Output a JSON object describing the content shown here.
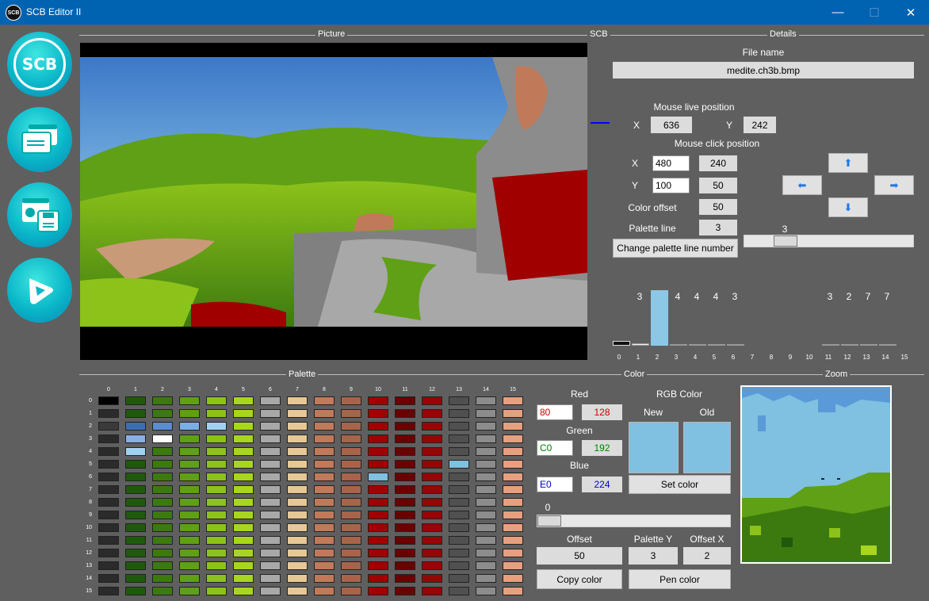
{
  "window": {
    "title": "SCB Editor II",
    "logo": "SCB",
    "minimize": "—",
    "maximize": "☐",
    "close": "✕"
  },
  "sidebar": {
    "logo_text": "SCB",
    "open_icon": "open-windows-icon",
    "save_icon": "save-settings-icon",
    "play_icon": "play-icon"
  },
  "sections": {
    "picture": "Picture",
    "scb": "SCB",
    "details": "Details",
    "palette": "Palette",
    "color": "Color",
    "zoom": "Zoom"
  },
  "details": {
    "file_name_label": "File name",
    "file_name": "medite.ch3b.bmp",
    "mouse_live_label": "Mouse live position",
    "live_x_label": "X",
    "live_x": "636",
    "live_y_label": "Y",
    "live_y": "242",
    "mouse_click_label": "Mouse click position",
    "click_x_label": "X",
    "click_x_input": "480",
    "click_x_value": "240",
    "click_y_label": "Y",
    "click_y_input": "100",
    "click_y_value": "50",
    "color_offset_label": "Color offset",
    "color_offset": "50",
    "palette_line_label": "Palette line",
    "palette_line": "3",
    "change_palette_button": "Change palette line number",
    "slider_value": "3",
    "slider_level": 0.2
  },
  "histogram": {
    "ticks": [
      "0",
      "1",
      "2",
      "3",
      "4",
      "5",
      "6",
      "7",
      "8",
      "9",
      "10",
      "11",
      "12",
      "13",
      "14",
      "15"
    ],
    "counts": [
      {
        "col": 1,
        "label": "3"
      },
      {
        "col": 3,
        "label": "4"
      },
      {
        "col": 4,
        "label": "4"
      },
      {
        "col": 5,
        "label": "4"
      },
      {
        "col": 6,
        "label": "3"
      },
      {
        "col": 11,
        "label": "3"
      },
      {
        "col": 12,
        "label": "2"
      },
      {
        "col": 13,
        "label": "7"
      },
      {
        "col": 14,
        "label": "7"
      }
    ],
    "values": [
      0.08,
      0.04,
      1.0,
      0.02,
      0.02,
      0.02,
      0.03,
      0,
      0,
      0,
      0,
      0.03,
      0.02,
      0.03,
      0.03,
      0
    ],
    "selected": 2
  },
  "palette": {
    "columns": [
      "0",
      "1",
      "2",
      "3",
      "4",
      "5",
      "6",
      "7",
      "8",
      "9",
      "10",
      "11",
      "12",
      "13",
      "14",
      "15"
    ],
    "rows": [
      "0",
      "1",
      "2",
      "3",
      "4",
      "5",
      "6",
      "7",
      "8",
      "9",
      "10",
      "11",
      "12",
      "13",
      "14",
      "15"
    ],
    "base_colors": [
      "#2b2b2b",
      "#1f5a0c",
      "#3c7a10",
      "#5fa016",
      "#8cc21a",
      "#a8d61e",
      "#a8a8a8",
      "#e6c896",
      "#c07a5a",
      "#a8644a",
      "#a00000",
      "#6a0000",
      "#960606",
      "#505050",
      "#8c8c8c",
      "#e6a080"
    ],
    "special": [
      {
        "row": 0,
        "col": 0,
        "color": "#000000"
      },
      {
        "row": 2,
        "col": 0,
        "color": "#3a3a3a"
      },
      {
        "row": 2,
        "col": 1,
        "color": "#3c6eb4"
      },
      {
        "row": 2,
        "col": 2,
        "color": "#5a8cd2"
      },
      {
        "row": 2,
        "col": 3,
        "color": "#7aaee6"
      },
      {
        "row": 2,
        "col": 4,
        "color": "#a0d2f0"
      },
      {
        "row": 3,
        "col": 1,
        "color": "#8caee6"
      },
      {
        "row": 3,
        "col": 2,
        "color": "#ffffff"
      },
      {
        "row": 4,
        "col": 1,
        "color": "#a0d2f0"
      },
      {
        "row": 5,
        "col": 13,
        "color": "#80c0e0"
      },
      {
        "row": 6,
        "col": 10,
        "color": "#80c0e0"
      }
    ]
  },
  "color": {
    "red_label": "Red",
    "red_hex": "80",
    "red_dec": "128",
    "red_color": "#cc0000",
    "green_label": "Green",
    "green_hex": "C0",
    "green_dec": "192",
    "green_color": "#008000",
    "blue_label": "Blue",
    "blue_hex": "E0",
    "blue_dec": "224",
    "blue_color": "#0000cc",
    "rgb_label": "RGB Color",
    "new_label": "New",
    "old_label": "Old",
    "new_color": "#80c0e0",
    "old_color": "#80c0e0",
    "set_color_button": "Set color",
    "slider_value": "0",
    "slider_level": 0.0,
    "offset_label": "Offset",
    "offset": "50",
    "palette_y_label": "Palette Y",
    "palette_y": "3",
    "offset_x_label": "Offset X",
    "offset_x": "2",
    "copy_color_button": "Copy color",
    "pen_color_button": "Pen color"
  }
}
